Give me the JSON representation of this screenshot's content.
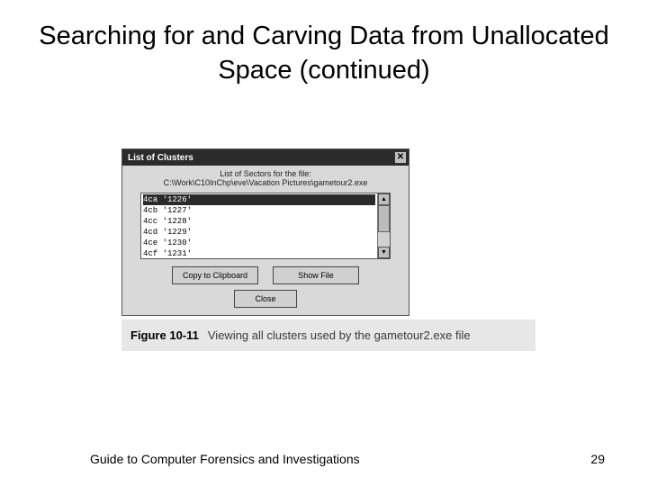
{
  "title": "Searching for and Carving Data from Unallocated Space (continued)",
  "dialog": {
    "title": "List of Clusters",
    "label_line1": "List of Sectors for the file:",
    "label_line2": "C:\\Work\\C10InChp\\eve\\Vacation Pictures\\gametour2.exe",
    "rows": [
      "4ca '1226'",
      "4cb '1227'",
      "4cc '1228'",
      "4cd '1229'",
      "4ce '1230'",
      "4cf '1231'"
    ],
    "copy_btn": "Copy to Clipboard",
    "show_btn": "Show File",
    "close_btn": "Close"
  },
  "caption": {
    "fignum": "Figure 10-11",
    "text": "Viewing all clusters used by the gametour2.exe file"
  },
  "footer": {
    "left": "Guide to Computer Forensics and Investigations",
    "right": "29"
  }
}
